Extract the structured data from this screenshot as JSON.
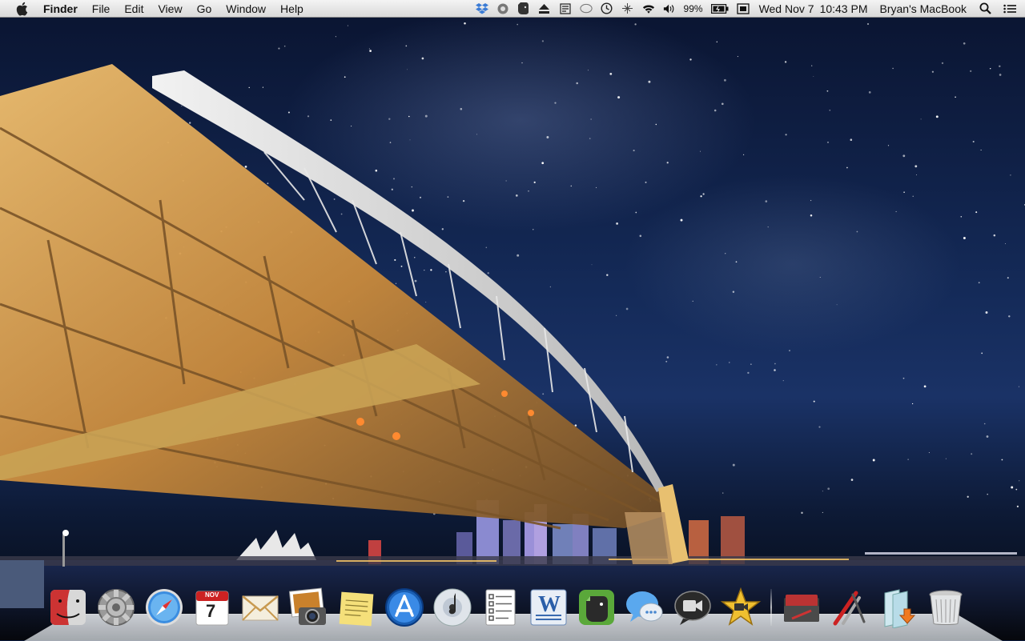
{
  "menubar": {
    "app_name": "Finder",
    "menus": [
      "File",
      "Edit",
      "View",
      "Go",
      "Window",
      "Help"
    ],
    "status_icons": [
      "dropbox-icon",
      "bluetooth-like-icon",
      "evernote-icon",
      "eject-icon",
      "input-menu-icon",
      "messages-icon",
      "time-machine-icon",
      "bluetooth-icon",
      "wifi-icon",
      "volume-icon"
    ],
    "battery_percent": "99%",
    "date": "Wed Nov 7",
    "time": "10:43 PM",
    "user": "Bryan's MacBook"
  },
  "dock": {
    "apps": [
      {
        "name": "Finder",
        "icon": "finder-icon"
      },
      {
        "name": "System Preferences",
        "icon": "system-preferences-icon"
      },
      {
        "name": "Safari",
        "icon": "safari-icon"
      },
      {
        "name": "Calendar",
        "icon": "calendar-icon",
        "month": "NOV",
        "day": "7"
      },
      {
        "name": "Mail",
        "icon": "mail-icon"
      },
      {
        "name": "iPhoto",
        "icon": "iphoto-icon"
      },
      {
        "name": "Stickies",
        "icon": "stickies-icon"
      },
      {
        "name": "App Store",
        "icon": "app-store-icon"
      },
      {
        "name": "iTunes",
        "icon": "itunes-icon"
      },
      {
        "name": "Reminders",
        "icon": "reminders-icon"
      },
      {
        "name": "Microsoft Word",
        "icon": "word-icon",
        "letter": "W"
      },
      {
        "name": "Evernote",
        "icon": "evernote-icon"
      },
      {
        "name": "Messages",
        "icon": "messages-icon"
      },
      {
        "name": "FaceTime",
        "icon": "facetime-icon"
      },
      {
        "name": "iMovie",
        "icon": "imovie-icon"
      }
    ],
    "stacks": [
      {
        "name": "Documents",
        "icon": "documents-stack-icon"
      },
      {
        "name": "Applications",
        "icon": "applications-stack-icon"
      },
      {
        "name": "Downloads",
        "icon": "downloads-stack-icon"
      },
      {
        "name": "Trash",
        "icon": "trash-icon"
      }
    ]
  },
  "colors": {
    "menubar_top": "#f4f4f4",
    "menubar_bottom": "#d9d9d9",
    "sky": "#142a58",
    "bridge": "#d8a050"
  }
}
